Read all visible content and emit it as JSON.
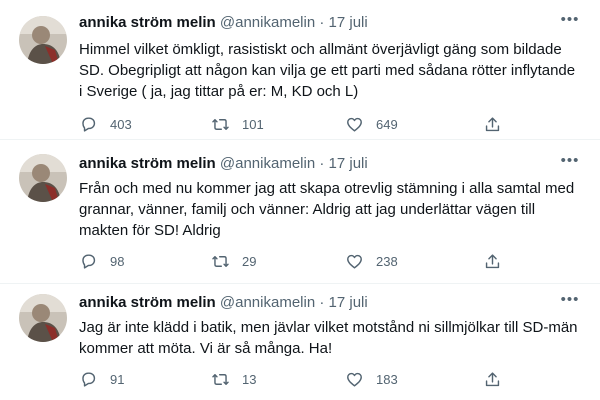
{
  "tweets": [
    {
      "name": "annika ström melin",
      "handle": "@annikamelin",
      "sep": "·",
      "date": "17 juli",
      "more": "•••",
      "text": "Himmel vilket ömkligt, rasistiskt och allmänt överjävligt gäng som bildade\nSD. Obegripligt att någon kan vilja ge ett parti med sådana rötter inflytande\ni Sverige ( ja, jag tittar på er: M, KD och L)",
      "replies": "403",
      "retweets": "101",
      "likes": "649"
    },
    {
      "name": "annika ström melin",
      "handle": "@annikamelin",
      "sep": "·",
      "date": "17 juli",
      "more": "•••",
      "text": "Från och med nu kommer jag att skapa otrevlig stämning i alla samtal med\ngrannar, vänner, familj och vänner: Aldrig att jag underlättar vägen till\nmakten för SD! Aldrig",
      "replies": "98",
      "retweets": "29",
      "likes": "238"
    },
    {
      "name": "annika ström melin",
      "handle": "@annikamelin",
      "sep": "·",
      "date": "17 juli",
      "more": "•••",
      "text": "Jag är inte klädd i batik, men jävlar vilket motstånd ni sillmjölkar till SD-män\nkommer att möta. Vi är så många. Ha!",
      "replies": "91",
      "retweets": "13",
      "likes": "183"
    }
  ],
  "icons": {
    "reply": "reply-icon",
    "retweet": "retweet-icon",
    "like": "heart-icon",
    "share": "share-icon",
    "more": "more-icon"
  },
  "colors": {
    "text": "#0f1419",
    "secondary": "#536471",
    "divider": "#eff3f4",
    "background": "#ffffff"
  }
}
